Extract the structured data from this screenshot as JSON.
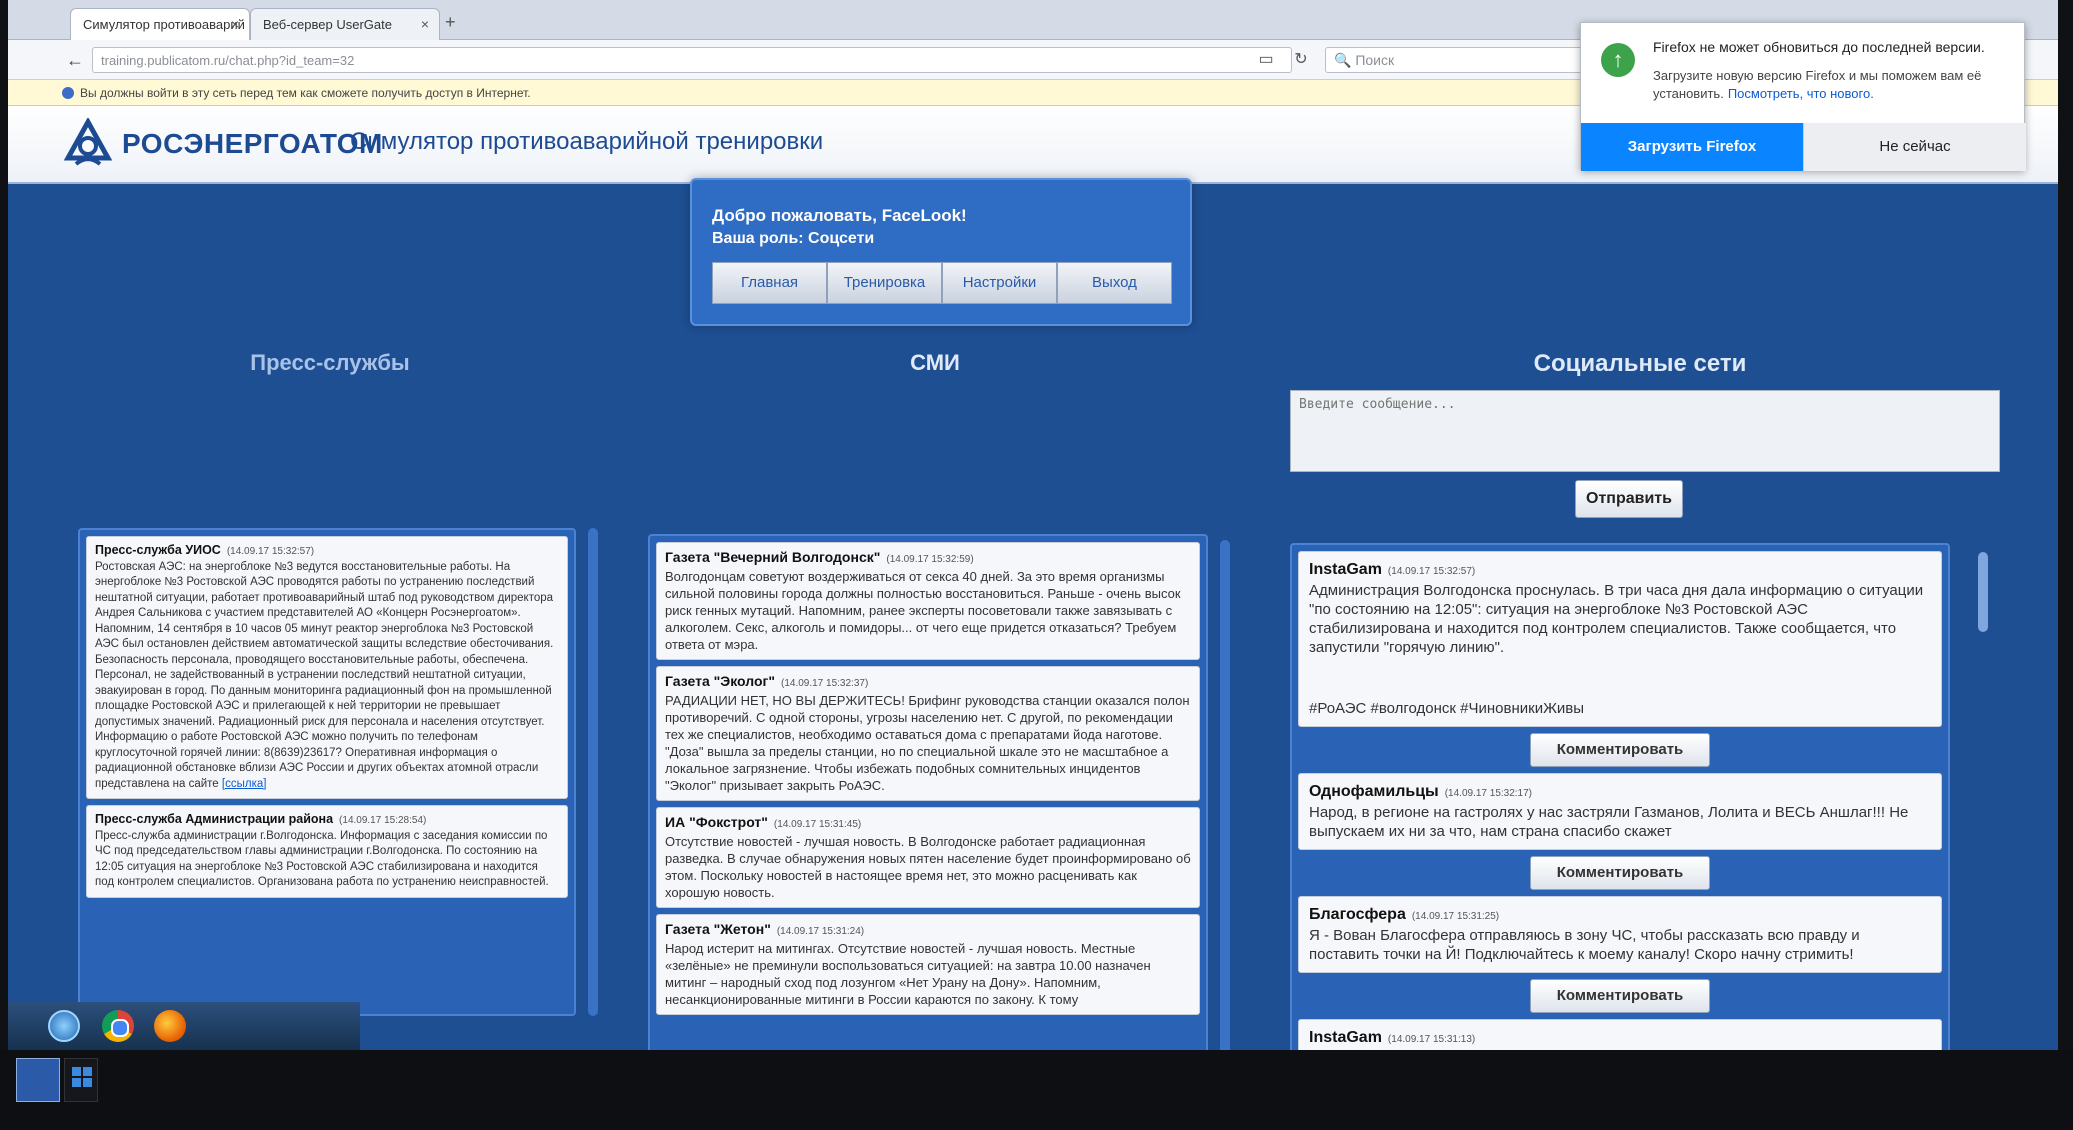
{
  "browser": {
    "tabs": [
      {
        "label": "Симулятор противоаварий"
      },
      {
        "label": "Веб-сервер UserGate"
      }
    ],
    "new_tab": "+",
    "url": "training.publicatom.ru/chat.php?id_team=32",
    "search_placeholder": "Поиск",
    "notice": "Вы должны войти в эту сеть перед тем как сможете получить доступ в Интернет."
  },
  "firefox_popup": {
    "title": "Firefox не может обновиться до последней версии.",
    "body": "Загрузите новую версию Firefox и мы поможем вам её установить.",
    "link": "Посмотреть, что нового.",
    "download_label": "Загрузить Firefox",
    "later_label": "Не сейчас"
  },
  "header": {
    "logo_text": "РОСЭНЕРГОАТОМ",
    "app_title": "Симулятор противоаварийной тренировки"
  },
  "welcome": {
    "greeting": "Добро пожаловать, FaceLook!",
    "role": "Ваша роль: Соцсети",
    "menu": [
      "Главная",
      "Тренировка",
      "Настройки",
      "Выход"
    ]
  },
  "columns": {
    "press_title": "Пресс-службы",
    "media_title": "СМИ",
    "social_title": "Социальные сети"
  },
  "social_input": {
    "placeholder": "Введите сообщение...",
    "send_label": "Отправить"
  },
  "press_items": [
    {
      "author": "Пресс-служба УИОС",
      "time": "(14.09.17 15:32:57)",
      "text": "Ростовская АЭС: на энергоблоке №3 ведутся восстановительные работы. На энергоблоке №3 Ростовской АЭС проводятся работы по устранению последствий нештатной ситуации, работает противоаварийный штаб под руководством директора Андрея Сальникова с участием представителей АО «Концерн Росэнергоатом». Напомним, 14 сентября в 10 часов 05 минут реактор энергоблока №3 Ростовской АЭС был остановлен действием автоматической защиты вследствие обесточивания. Безопасность персонала, проводящего восстановительные работы, обеспечена. Персонал, не задействованный в устранении последствий нештатной ситуации, эвакуирован в город. По данным мониторинга радиационный фон на промышленной площадке Ростовской АЭС и прилегающей к ней территории не превышает допустимых значений. Радиационный риск для персонала и населения отсутствует. Информацию о работе Ростовской АЭС можно получить по телефонам круглосуточной горячей линии: 8(8639)23617? Оперативная информация о радиационной обстановке вблизи АЭС России и других объектах атомной отрасли представлена на сайте",
      "link": "[ссылка]"
    },
    {
      "author": "Пресс-служба Администрации района",
      "time": "(14.09.17 15:28:54)",
      "text": "Пресс-служба администрации г.Волгодонска. Информация с заседания комиссии по ЧС под председательством главы администрации г.Волгодонска. По состоянию на 12:05 ситуация на энергоблоке №3 Ростовской АЭС стабилизирована и находится под контролем специалистов. Организована работа по устранению неисправностей."
    }
  ],
  "media_items": [
    {
      "author": "Газета \"Вечерний Волгодонск\"",
      "time": "(14.09.17 15:32:59)",
      "text": "Волгодонцам советуют воздерживаться от секса 40 дней. За это время организмы сильной половины города должны полностью восстановиться. Раньше - очень высок риск генных мутаций. Напомним, ранее эксперты посоветовали также завязывать с алкоголем. Секс, алкоголь и помидоры... от чего еще придется отказаться? Требуем ответа от мэра."
    },
    {
      "author": "Газета \"Эколог\"",
      "time": "(14.09.17 15:32:37)",
      "text": "РАДИАЦИИ НЕТ, НО ВЫ ДЕРЖИТЕСЬ! Брифинг руководства станции оказался полон противоречий. С одной стороны, угрозы населению нет. С другой, по рекомендации тех же специалистов, необходимо оставаться дома с препаратами йода наготове. \"Доза\" вышла за пределы станции, но по специальной шкале это не масштабное а локальное загрязнение. Чтобы избежать подобных сомнительных инцидентов \"Эколог\" призывает закрыть РоАЭС."
    },
    {
      "author": "ИА \"Фокстрот\"",
      "time": "(14.09.17 15:31:45)",
      "text": "Отсутствие новостей - лучшая новость. В Волгодонске работает радиационная разведка. В случае обнаружения новых пятен население будет проинформировано об этом. Поскольку новостей в настоящее время нет, это можно расценивать как хорошую новость."
    },
    {
      "author": "Газета \"Жетон\"",
      "time": "(14.09.17 15:31:24)",
      "text": "Народ истерит на митингах. Отсутствие новостей - лучшая новость. Местные «зелёные» не преминули воспользоваться ситуацией: на завтра 10.00 назначен митинг – народный сход под лозунгом «Нет Урану на Дону». Напомним, несанкционированные митинги в России караются по закону. К тому"
    }
  ],
  "social_items": [
    {
      "author": "InstaGam",
      "time": "(14.09.17 15:32:57)",
      "text": "Администрация Волгодонска проснулась. В три часа дня дала информацию о ситуации \"по состоянию на 12:05\": ситуация на энергоблоке №3 Ростовской АЭС стабилизирована и находится под контролем специалистов. Также сообщается, что запустили \"горячую линию\".",
      "tags": "#РоАЭС #волгодонск #ЧиновникиЖивы",
      "comment_label": "Комментировать"
    },
    {
      "author": "Однофамильцы",
      "time": "(14.09.17 15:32:17)",
      "text": "Народ, в регионе на гастролях у нас застряли Газманов, Лолита и ВЕСЬ Аншлаг!!! Не выпускаем их ни за что, нам страна спасибо скажет",
      "comment_label": "Комментировать"
    },
    {
      "author": "Благосфера",
      "time": "(14.09.17 15:31:25)",
      "text": "Я - Вован Благосфера отправляюсь в зону ЧС, чтобы рассказать всю правду и поставить точки на Й! Подключайтесь к моему каналу! Скоро начну стримить!",
      "comment_label": "Комментировать"
    },
    {
      "author": "InstaGam",
      "time": "(14.09.17 15:31:13)",
      "text": ""
    }
  ]
}
